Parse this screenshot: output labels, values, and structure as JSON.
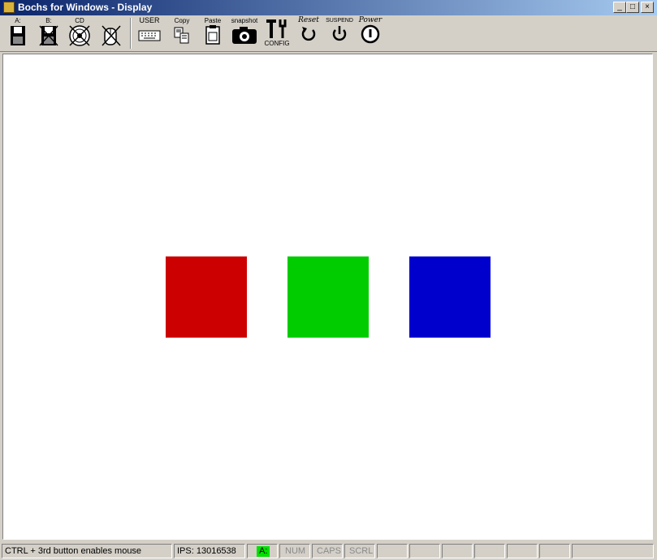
{
  "window": {
    "title": "Bochs for Windows - Display",
    "minimize": "_",
    "maximize": "□",
    "close": "×"
  },
  "toolbar": {
    "floppy_a": "A:",
    "floppy_b": "B:",
    "cdrom": "CD",
    "user": "USER",
    "copy": "Copy",
    "paste": "Paste",
    "snapshot": "snapshot",
    "config": "CONFIG",
    "reset": "Reset",
    "suspend": "SUSPEND",
    "power": "Power"
  },
  "display": {
    "colors": {
      "red": "#cc0000",
      "green": "#00cc00",
      "blue": "#0000cc"
    }
  },
  "status": {
    "hint": "CTRL + 3rd button enables mouse",
    "ips": "IPS:  13016538",
    "drive": "A:",
    "num": "NUM",
    "caps": "CAPS",
    "scrl": "SCRL"
  }
}
